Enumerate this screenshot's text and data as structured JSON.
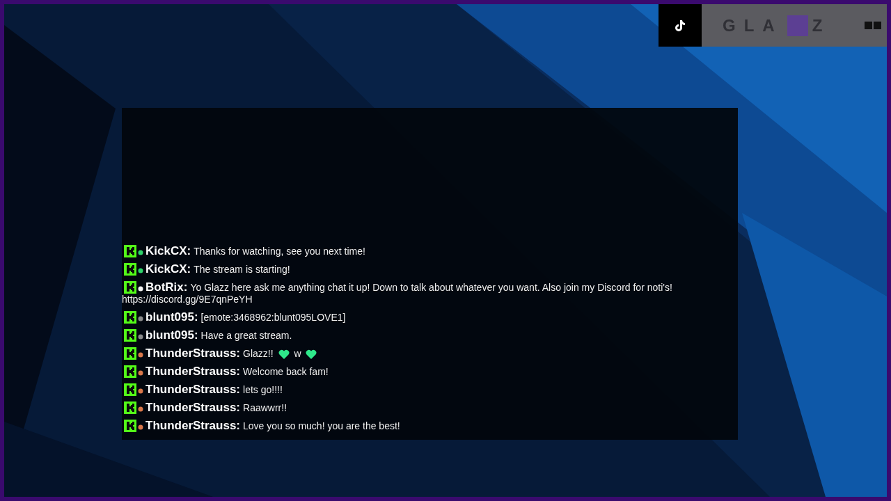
{
  "top_bar": {
    "logo_left": "GLA",
    "logo_right": "Z"
  },
  "chat": {
    "messages": [
      {
        "user": "KickCX:",
        "color": "#2fd46a",
        "parts": [
          {
            "kind": "text",
            "text": "Thanks for watching, see you next time!"
          }
        ]
      },
      {
        "user": "KickCX:",
        "color": "#2fd46a",
        "parts": [
          {
            "kind": "text",
            "text": "The stream is starting!"
          }
        ]
      },
      {
        "user": "BotRix:",
        "color": "#f2f2f2",
        "parts": [
          {
            "kind": "text",
            "text": "Yo Glazz here ask me anything chat it up! Down to talk about whatever you want. Also join my Discord for noti's!"
          },
          {
            "kind": "line",
            "text": "https://discord.gg/9E7qnPeYH"
          }
        ]
      },
      {
        "user": "blunt095:",
        "color": "#8a8a8a",
        "parts": [
          {
            "kind": "text",
            "text": "[emote:3468962:blunt095LOVE1]"
          }
        ]
      },
      {
        "user": "blunt095:",
        "color": "#8a8a8a",
        "parts": [
          {
            "kind": "text",
            "text": "Have a great stream."
          }
        ]
      },
      {
        "user": "ThunderStrauss:",
        "color": "#d9774a",
        "parts": [
          {
            "kind": "text",
            "text": "Glazz!!"
          },
          {
            "kind": "emote"
          },
          {
            "kind": "text",
            "text": "w"
          },
          {
            "kind": "emote"
          }
        ]
      },
      {
        "user": "ThunderStrauss:",
        "color": "#d9774a",
        "parts": [
          {
            "kind": "text",
            "text": "Welcome back fam!"
          }
        ]
      },
      {
        "user": "ThunderStrauss:",
        "color": "#d9774a",
        "parts": [
          {
            "kind": "text",
            "text": "lets go!!!!"
          }
        ]
      },
      {
        "user": "ThunderStrauss:",
        "color": "#d9774a",
        "parts": [
          {
            "kind": "text",
            "text": "Raawwrr!!"
          }
        ]
      },
      {
        "user": "ThunderStrauss:",
        "color": "#d9774a",
        "parts": [
          {
            "kind": "text",
            "text": "Love you so much! you are the best!"
          }
        ]
      }
    ]
  }
}
